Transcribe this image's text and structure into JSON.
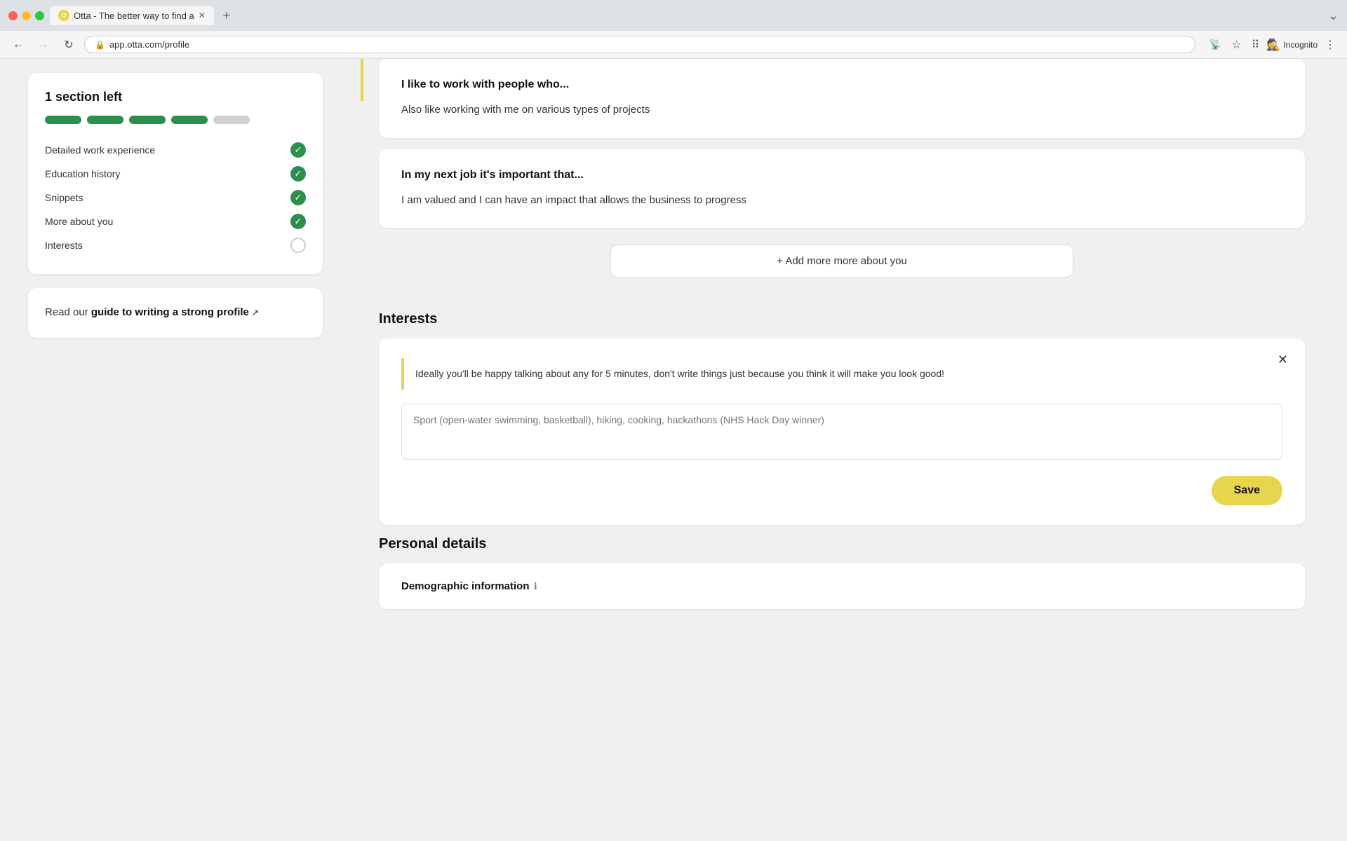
{
  "browser": {
    "tab_title": "Otta - The better way to find a",
    "tab_favicon": "O",
    "url": "app.otta.com/profile",
    "incognito_label": "Incognito"
  },
  "sidebar": {
    "progress_title": "1 section left",
    "pills": [
      {
        "color": "green"
      },
      {
        "color": "green"
      },
      {
        "color": "green"
      },
      {
        "color": "green"
      },
      {
        "color": "gray"
      }
    ],
    "checklist": [
      {
        "label": "Detailed work experience",
        "done": true
      },
      {
        "label": "Education history",
        "done": true
      },
      {
        "label": "Snippets",
        "done": true
      },
      {
        "label": "More about you",
        "done": true
      },
      {
        "label": "Interests",
        "done": false
      }
    ],
    "guide_text_prefix": "Read our ",
    "guide_link_text": "guide to writing a strong profile",
    "guide_icon": "↗"
  },
  "main": {
    "card1": {
      "question": "I like to work with people who...",
      "answer": "Also like working with me on various types of projects"
    },
    "card2": {
      "question": "In my next job it's important that...",
      "answer": "I am valued and I can have an impact that allows the business to progress"
    },
    "add_more_label": "+ Add more more about you",
    "interests_section_title": "Interests",
    "interests_warning": "Ideally you'll be happy talking about any for 5 minutes, don't write things just because you think it will make you look good!",
    "interests_placeholder": "Sport (open-water swimming, basketball), hiking, cooking, hackathons (NHS Hack Day winner)",
    "save_label": "Save",
    "personal_details_title": "Personal details",
    "demographic_label": "Demographic information",
    "demographic_info_icon": "ℹ"
  }
}
